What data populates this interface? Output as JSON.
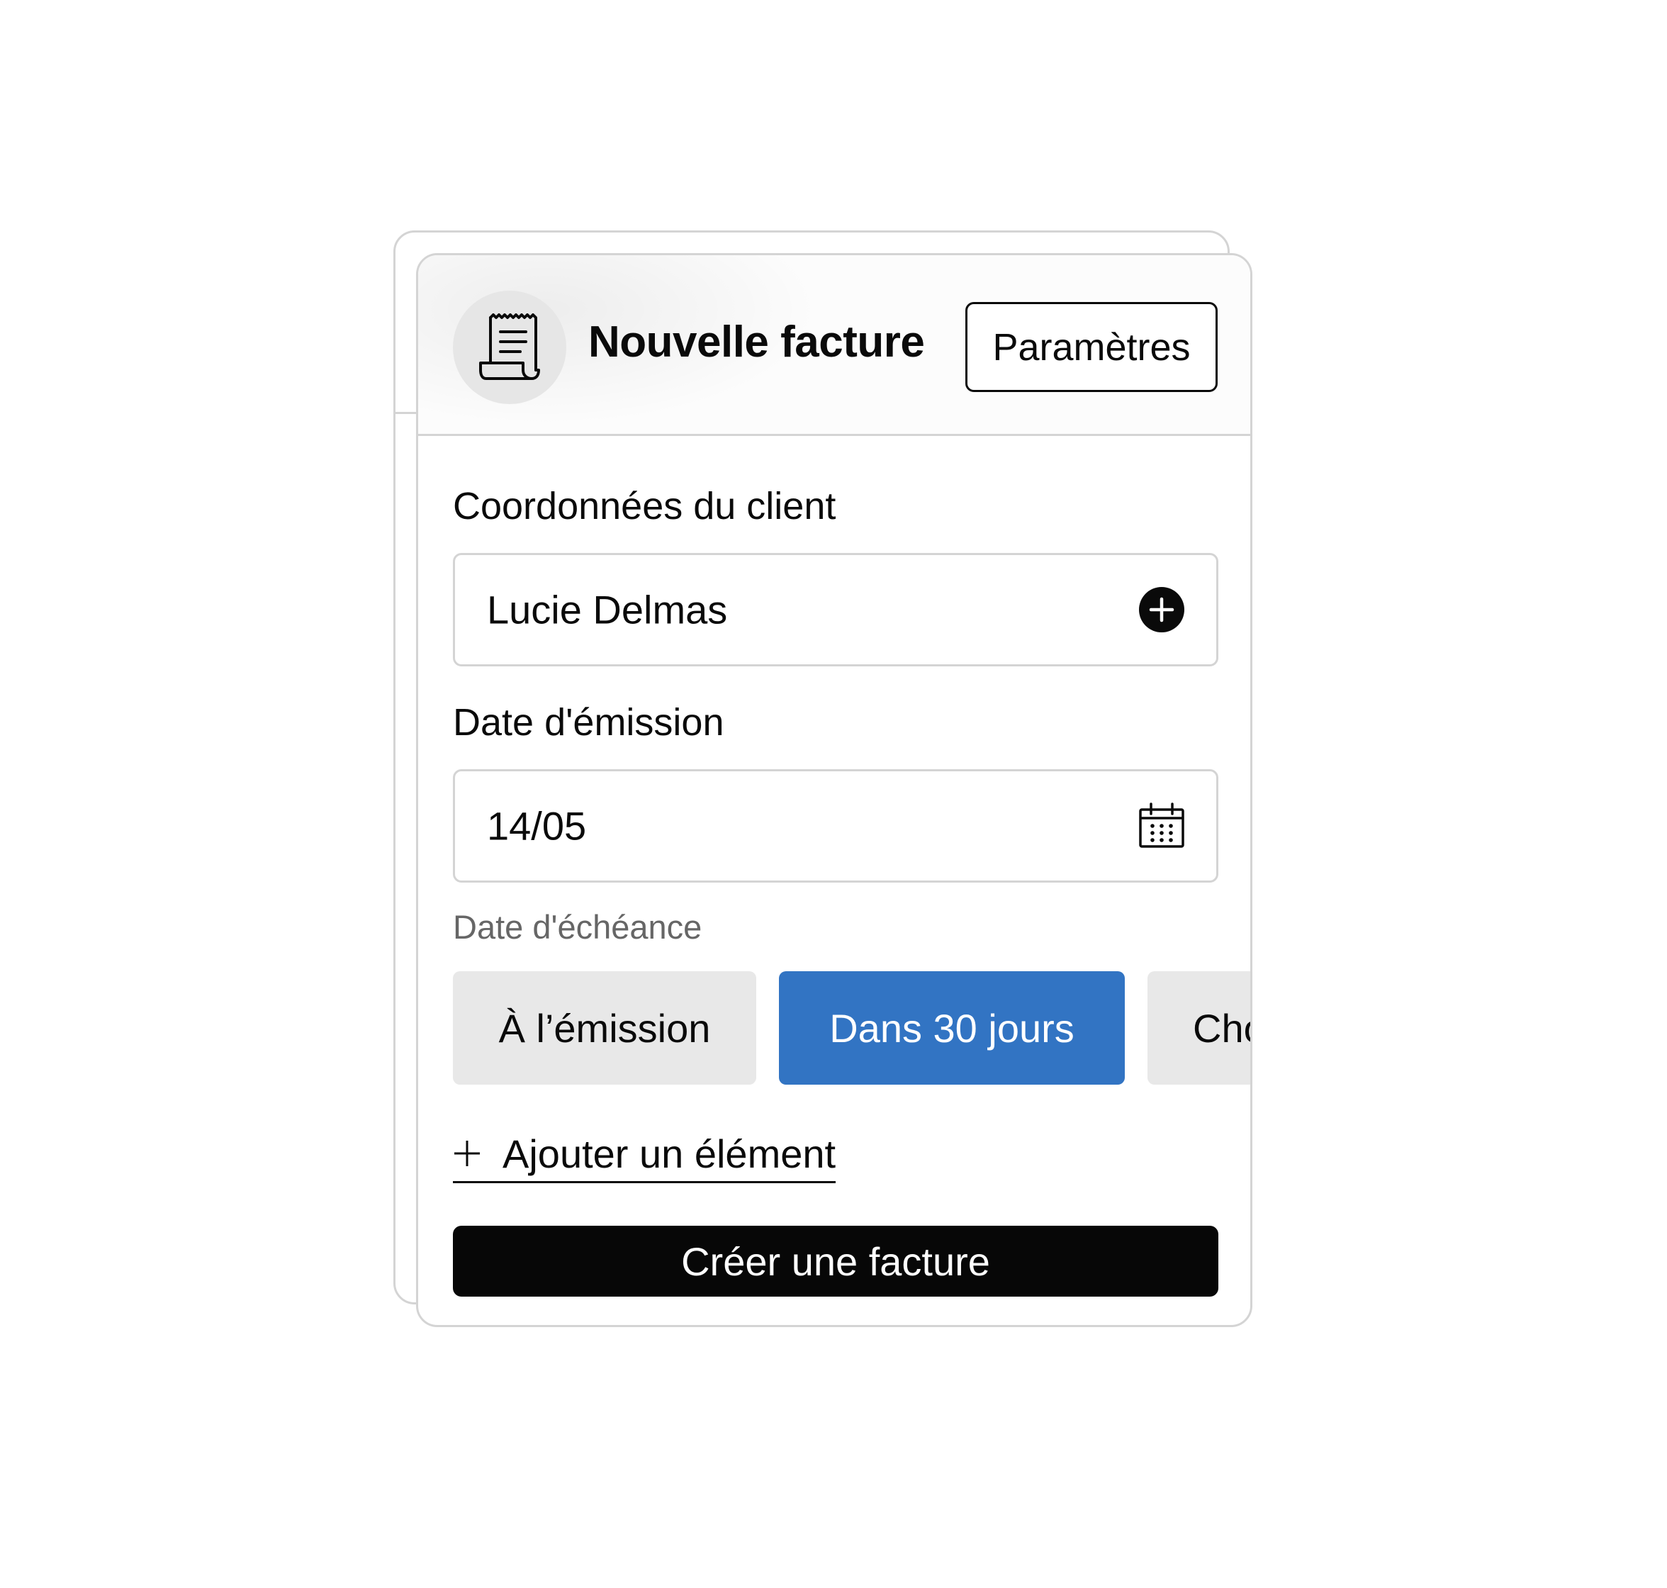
{
  "header": {
    "title": "Nouvelle facture",
    "settings_label": "Paramètres",
    "icon": "receipt-icon"
  },
  "client": {
    "label": "Coordonnées du client",
    "value": "Lucie Delmas",
    "icon": "add-circle-icon"
  },
  "issue_date": {
    "label": "Date d'émission",
    "value": "14/05",
    "icon": "calendar-icon"
  },
  "due_date": {
    "label": "Date d'échéance",
    "options": [
      {
        "label": "À l’émission",
        "selected": false
      },
      {
        "label": "Dans 30 jours",
        "selected": true
      },
      {
        "label": "Cho",
        "selected": false
      }
    ]
  },
  "add_item": {
    "label": "Ajouter un élément",
    "icon": "plus-icon"
  },
  "submit": {
    "label": "Créer une facture"
  },
  "colors": {
    "accent": "#3274c3",
    "primary_button": "#070707",
    "border": "#d4d4d4",
    "chip_bg": "#e8e8e8",
    "muted_text": "#666666"
  }
}
